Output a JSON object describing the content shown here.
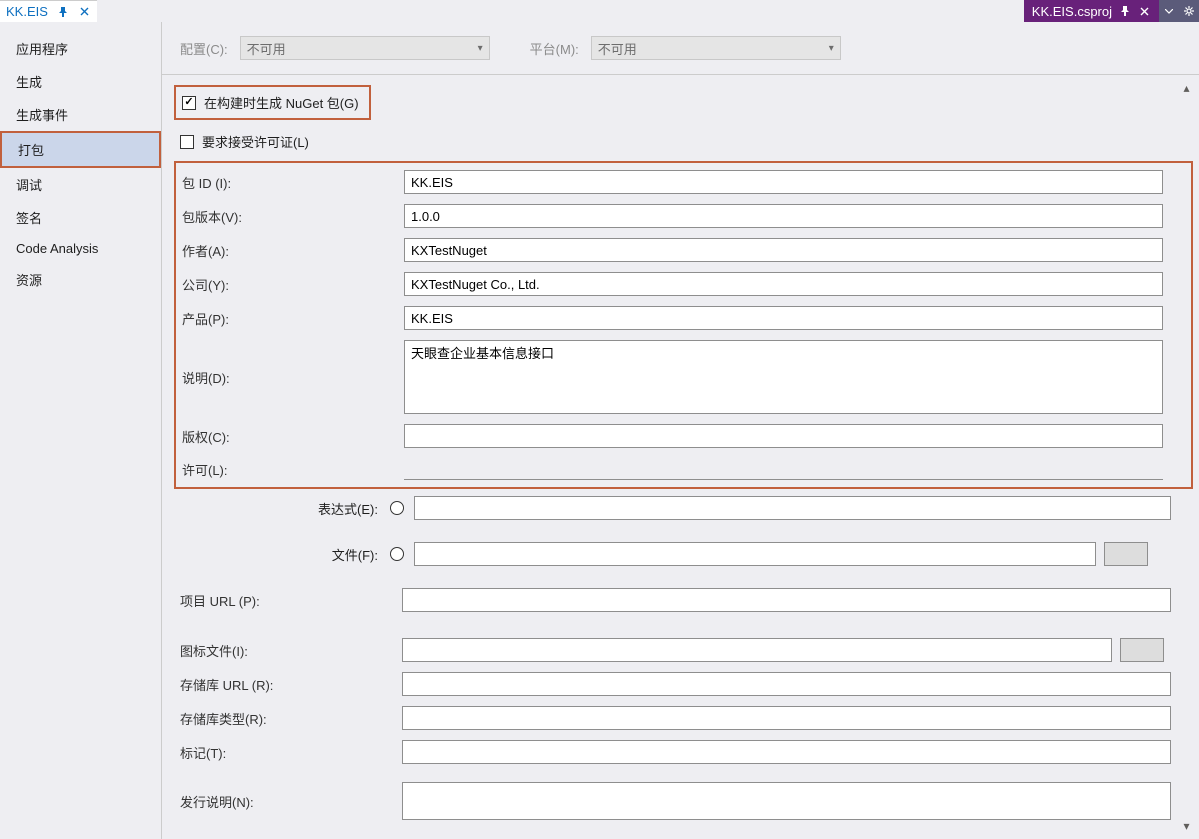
{
  "tabs": {
    "left": {
      "title": "KK.EIS"
    },
    "right": {
      "title": "KK.EIS.csproj"
    }
  },
  "config": {
    "configLabel": "配置(C):",
    "configValue": "不可用",
    "platformLabel": "平台(M):",
    "platformValue": "不可用"
  },
  "sidebar": {
    "items": [
      "应用程序",
      "生成",
      "生成事件",
      "打包",
      "调试",
      "签名",
      "Code Analysis",
      "资源"
    ],
    "selectedIndex": 3
  },
  "checkboxes": {
    "genNuget": {
      "label": "在构建时生成 NuGet 包(G)",
      "checked": true
    },
    "acceptLicense": {
      "label": "要求接受许可证(L)",
      "checked": false
    }
  },
  "fields": {
    "packageId": {
      "label": "包 ID (I):",
      "value": "KK.EIS"
    },
    "version": {
      "label": "包版本(V):",
      "value": "1.0.0"
    },
    "author": {
      "label": "作者(A):",
      "value": "KXTestNuget"
    },
    "company": {
      "label": "公司(Y):",
      "value": "KXTestNuget Co., Ltd."
    },
    "product": {
      "label": "产品(P):",
      "value": "KK.EIS"
    },
    "description": {
      "label": "说明(D):",
      "value": "天眼查企业基本信息接口"
    },
    "copyright": {
      "label": "版权(C):",
      "value": ""
    },
    "license": {
      "label": "许可(L):",
      "value": ""
    },
    "expression": {
      "label": "表达式(E):",
      "value": ""
    },
    "file": {
      "label": "文件(F):",
      "value": ""
    },
    "projectUrl": {
      "label": "项目 URL (P):",
      "value": ""
    },
    "iconFile": {
      "label": "图标文件(I):",
      "value": ""
    },
    "repoUrl": {
      "label": "存储库 URL (R):",
      "value": ""
    },
    "repoType": {
      "label": "存储库类型(R):",
      "value": ""
    },
    "tags": {
      "label": "标记(T):",
      "value": ""
    },
    "releaseNotes": {
      "label": "发行说明(N):",
      "value": ""
    }
  }
}
